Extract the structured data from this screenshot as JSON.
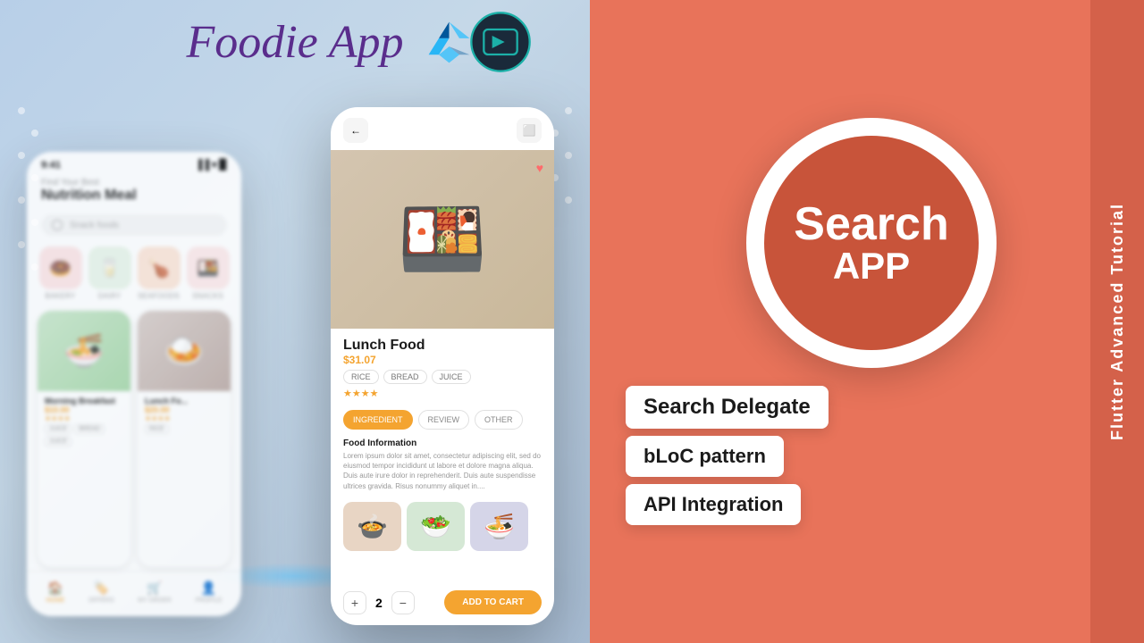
{
  "left_panel": {
    "title": "Foodie App",
    "phone_left": {
      "status_time": "9:41",
      "header_sub": "Find Your Best",
      "header_title": "Nutrition Meal",
      "search_placeholder": "Snack foods",
      "categories": [
        {
          "label": "BAKERY",
          "emoji": "🍩",
          "bg": "cat-bakery"
        },
        {
          "label": "DAIRY",
          "emoji": "🥛",
          "bg": "cat-dairy"
        },
        {
          "label": "SEAFOODS",
          "emoji": "🍗",
          "bg": "cat-seafood"
        },
        {
          "label": "SNACKS",
          "emoji": "🍱",
          "bg": "cat-snacks"
        }
      ],
      "food_cards": [
        {
          "name": "Morning Breakfast",
          "price": "$10.00",
          "stars": "★★★★",
          "tags": [
            "JUICE",
            "BREAD",
            "JUICE"
          ],
          "emoji": "🍜",
          "bg": "food-card-img-green"
        },
        {
          "name": "Lunch Fo...",
          "price": "$20.00",
          "stars": "★★★★",
          "tags": [
            "RICE"
          ],
          "emoji": "🍛",
          "bg": "food-card-img-brown"
        }
      ],
      "nav_items": [
        {
          "label": "HOME",
          "icon": "🏠",
          "active": true
        },
        {
          "label": "OFFERS",
          "icon": "🏷️",
          "active": false
        },
        {
          "label": "MY ORDER",
          "icon": "🛒",
          "active": false
        },
        {
          "label": "PROFILE",
          "icon": "👤",
          "active": false
        }
      ]
    },
    "phone_right": {
      "food_name": "Lunch Food",
      "food_price": "$31.07",
      "tags": [
        "RICE",
        "BREAD",
        "JUICE"
      ],
      "stars": "★★★★",
      "tabs": [
        "INGREDIENT",
        "REVIEW",
        "OTHER"
      ],
      "active_tab": "INGREDIENT",
      "info_title": "Food Information",
      "info_text": "Lorem ipsum dolor sit amet, consectetur adipiscing elit, sed do eiusmod tempor incididunt ut labore et dolore magna aliqua. Duis aute irure dolor in reprehenderit. Duis aute suspendisse ultrices gravida. Risus nonummy aliquet in....",
      "quantity": "2",
      "add_to_cart_label": "ADD TO CART"
    }
  },
  "right_panel": {
    "circle_text_line1": "Search",
    "circle_text_line2": "APP",
    "features": [
      "Search Delegate",
      "bLoC pattern",
      "API Integration"
    ],
    "vertical_text": "Flutter Advanced Tutorial",
    "flutter_icon_color": "#54c5f8",
    "bloc_icon_color": "#1cb0a8"
  }
}
